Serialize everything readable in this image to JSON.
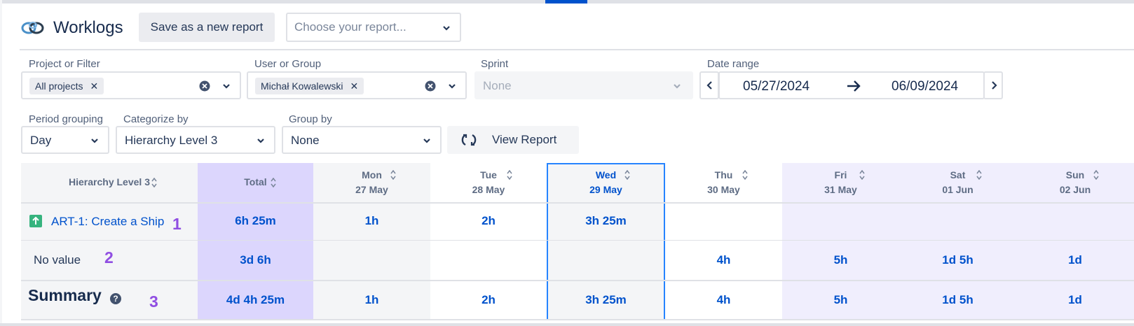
{
  "header": {
    "title": "Worklogs",
    "save_label": "Save as a new report",
    "report_placeholder": "Choose your report..."
  },
  "filters": {
    "project": {
      "label": "Project or Filter",
      "tag": "All projects"
    },
    "user": {
      "label": "User or Group",
      "tag": "Michał Kowalewski"
    },
    "sprint": {
      "label": "Sprint",
      "value": "None"
    },
    "date_range": {
      "label": "Date range",
      "start": "05/27/2024",
      "end": "06/09/2024"
    },
    "period": {
      "label": "Period grouping",
      "value": "Day"
    },
    "categorize": {
      "label": "Categorize by",
      "value": "Hierarchy Level 3"
    },
    "group": {
      "label": "Group by",
      "value": "None"
    },
    "view_label": "View Report"
  },
  "table": {
    "first_header": "Hierarchy Level 3",
    "total_header": "Total",
    "days": [
      {
        "dow": "Mon",
        "date": "27 May"
      },
      {
        "dow": "Tue",
        "date": "28 May"
      },
      {
        "dow": "Wed",
        "date": "29 May"
      },
      {
        "dow": "Thu",
        "date": "30 May"
      },
      {
        "dow": "Fri",
        "date": "31 May"
      },
      {
        "dow": "Sat",
        "date": "01 Jun"
      },
      {
        "dow": "Sun",
        "date": "02 Jun"
      }
    ],
    "rows": [
      {
        "label": "ART-1: Create a Ship",
        "marker": "1",
        "total": "6h 25m",
        "values": [
          "1h",
          "2h",
          "3h 25m",
          "",
          "",
          "",
          ""
        ]
      },
      {
        "label": "No value",
        "marker": "2",
        "total": "3d 6h",
        "values": [
          "",
          "",
          "",
          "4h",
          "5h",
          "1d 5h",
          "1d"
        ]
      }
    ],
    "summary": {
      "label": "Summary",
      "marker": "3",
      "total": "4d 4h 25m",
      "values": [
        "1h",
        "2h",
        "3h 25m",
        "4h",
        "5h",
        "1d 5h",
        "1d"
      ]
    }
  },
  "colors": {
    "accent": "#0052cc",
    "total_column": "#dcd6fd",
    "weekend_column": "#f0eefd",
    "marker": "#904ee2",
    "issue_icon": "#36b37e"
  }
}
